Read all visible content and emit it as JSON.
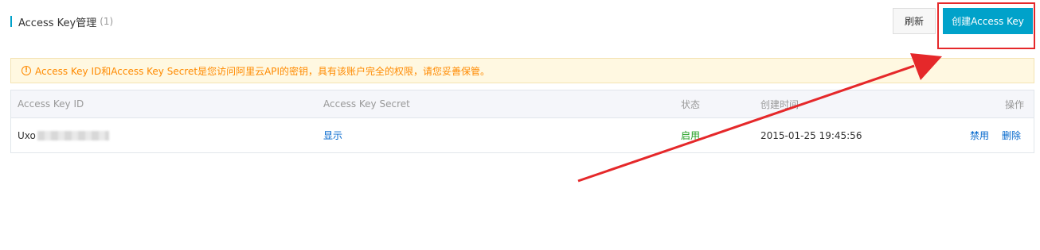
{
  "header": {
    "title": "Access Key管理",
    "count": "(1)",
    "refresh_label": "刷新",
    "create_label": "创建Access Key"
  },
  "alert": {
    "icon": "!",
    "text": "Access Key ID和Access Key Secret是您访问阿里云API的密钥，具有该账户完全的权限，请您妥善保管。"
  },
  "table": {
    "columns": [
      "Access Key ID",
      "Access Key Secret",
      "状态",
      "创建时间",
      "操作"
    ],
    "rows": [
      {
        "id_visible": "Uxo",
        "secret_action": "显示",
        "status": "启用",
        "created": "2015-01-25 19:45:56",
        "action_disable": "禁用",
        "action_delete": "删除"
      }
    ]
  },
  "colors": {
    "primary": "#00a2ca",
    "warning": "#ff8a00",
    "link": "#0066cc",
    "status_enabled": "#1e9e1e",
    "annotation": "#e5282a"
  }
}
